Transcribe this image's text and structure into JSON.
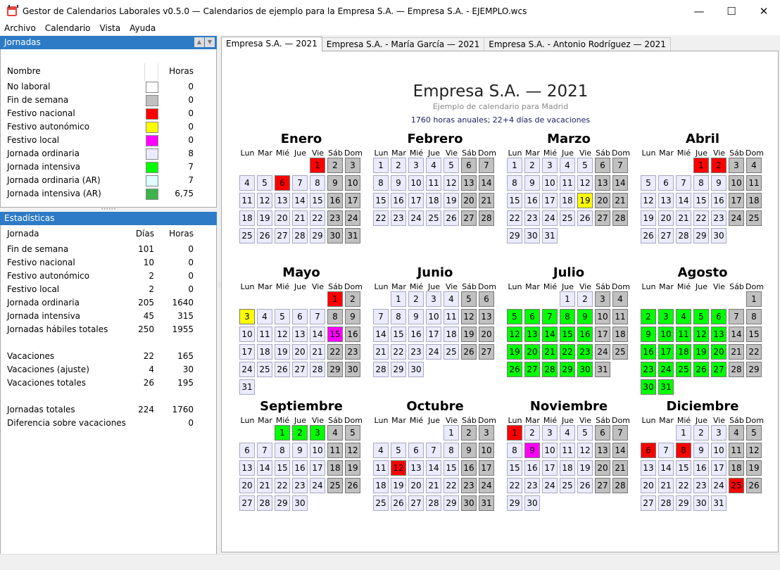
{
  "window": {
    "title": "Gestor de Calendarios Laborales v0.5.0 — Calendarios de ejemplo para la Empresa S.A. — Empresa S.A. - EJEMPLO.wcs",
    "minimize": "—",
    "maximize": "☐",
    "close": "✕"
  },
  "menu": [
    "Archivo",
    "Calendario",
    "Vista",
    "Ayuda"
  ],
  "jornadas": {
    "title": "Jornadas",
    "col_name": "Nombre",
    "col_hours": "Horas",
    "rows": [
      {
        "name": "No laboral",
        "color": "#ffffff",
        "hours": "0"
      },
      {
        "name": "Fin de semana",
        "color": "#c0c0c0",
        "hours": "0"
      },
      {
        "name": "Festivo nacional",
        "color": "#ff0000",
        "hours": "0"
      },
      {
        "name": "Festivo autonómico",
        "color": "#ffff00",
        "hours": "0"
      },
      {
        "name": "Festivo local",
        "color": "#ff00ff",
        "hours": "0"
      },
      {
        "name": "Jornada ordinaria",
        "color": "#ebebff",
        "hours": "8"
      },
      {
        "name": "Jornada intensiva",
        "color": "#00ff00",
        "hours": "7"
      },
      {
        "name": "Jornada ordinaria (AR)",
        "color": "#e0ffff",
        "hours": "7"
      },
      {
        "name": "Jornada intensiva (AR)",
        "color": "#3cb44b",
        "hours": "6,75"
      }
    ]
  },
  "stats": {
    "title": "Estadísticas",
    "col_name": "Jornada",
    "col_days": "Días",
    "col_hours": "Horas",
    "rows": [
      {
        "name": "Fin de semana",
        "days": "101",
        "hours": "0"
      },
      {
        "name": "Festivo nacional",
        "days": "10",
        "hours": "0"
      },
      {
        "name": "Festivo autonómico",
        "days": "2",
        "hours": "0"
      },
      {
        "name": "Festivo local",
        "days": "2",
        "hours": "0"
      },
      {
        "name": "Jornada ordinaria",
        "days": "205",
        "hours": "1640"
      },
      {
        "name": "Jornada intensiva",
        "days": "45",
        "hours": "315"
      },
      {
        "name": "Jornadas hábiles totales",
        "days": "250",
        "hours": "1955"
      },
      {
        "name": "",
        "days": "",
        "hours": ""
      },
      {
        "name": "Vacaciones",
        "days": "22",
        "hours": "165"
      },
      {
        "name": "Vacaciones (ajuste)",
        "days": "4",
        "hours": "30"
      },
      {
        "name": "Vacaciones totales",
        "days": "26",
        "hours": "195"
      },
      {
        "name": "",
        "days": "",
        "hours": ""
      },
      {
        "name": "Jornadas totales",
        "days": "224",
        "hours": "1760"
      },
      {
        "name": "Diferencia sobre vacaciones",
        "days": "",
        "hours": "0"
      }
    ]
  },
  "tabs": [
    "Empresa S.A. — 2021",
    "Empresa S.A. - María García — 2021",
    "Empresa S.A. - Antonio Rodríguez — 2021"
  ],
  "calendar": {
    "title": "Empresa S.A. — 2021",
    "subtitle": "Ejemplo de calendario para Madrid",
    "summary": "1760 horas anuales; 22+4 días de vacaciones",
    "day_names": [
      "Lun",
      "Mar",
      "Mié",
      "Jue",
      "Vie",
      "Sáb",
      "Dom"
    ],
    "colors": {
      "normal": "#ebebff",
      "weekend": "#c0c0c0",
      "national": "#ff0000",
      "regional": "#ffff00",
      "local": "#ff00ff",
      "intensive": "#00ff00"
    },
    "months": [
      {
        "name": "Enero",
        "start": 4,
        "days": 31,
        "national": [
          1,
          6
        ],
        "regional": [],
        "local": [],
        "intensive": []
      },
      {
        "name": "Febrero",
        "start": 0,
        "days": 28,
        "national": [],
        "regional": [],
        "local": [],
        "intensive": []
      },
      {
        "name": "Marzo",
        "start": 0,
        "days": 31,
        "national": [],
        "regional": [
          19
        ],
        "local": [],
        "intensive": []
      },
      {
        "name": "Abril",
        "start": 3,
        "days": 30,
        "national": [
          1,
          2
        ],
        "regional": [],
        "local": [],
        "intensive": []
      },
      {
        "name": "Mayo",
        "start": 5,
        "days": 31,
        "national": [
          1
        ],
        "regional": [
          3
        ],
        "local": [
          15
        ],
        "intensive": []
      },
      {
        "name": "Junio",
        "start": 1,
        "days": 30,
        "national": [],
        "regional": [],
        "local": [],
        "intensive": []
      },
      {
        "name": "Julio",
        "start": 3,
        "days": 31,
        "national": [],
        "regional": [],
        "local": [],
        "intensive": [
          5,
          6,
          7,
          8,
          9,
          12,
          13,
          14,
          15,
          16,
          19,
          20,
          21,
          22,
          23,
          26,
          27,
          28,
          29,
          30
        ]
      },
      {
        "name": "Agosto",
        "start": 6,
        "days": 31,
        "national": [],
        "regional": [],
        "local": [],
        "intensive": [
          2,
          3,
          4,
          5,
          6,
          9,
          10,
          11,
          12,
          13,
          16,
          17,
          18,
          19,
          20,
          23,
          24,
          25,
          26,
          27,
          30,
          31
        ]
      },
      {
        "name": "Septiembre",
        "start": 2,
        "days": 30,
        "national": [],
        "regional": [],
        "local": [],
        "intensive": [
          1,
          2,
          3
        ]
      },
      {
        "name": "Octubre",
        "start": 4,
        "days": 31,
        "national": [
          12
        ],
        "regional": [],
        "local": [],
        "intensive": []
      },
      {
        "name": "Noviembre",
        "start": 0,
        "days": 30,
        "national": [
          1
        ],
        "regional": [],
        "local": [
          9
        ],
        "intensive": []
      },
      {
        "name": "Diciembre",
        "start": 2,
        "days": 31,
        "national": [
          6,
          8,
          25
        ],
        "regional": [],
        "local": [],
        "intensive": []
      }
    ]
  }
}
